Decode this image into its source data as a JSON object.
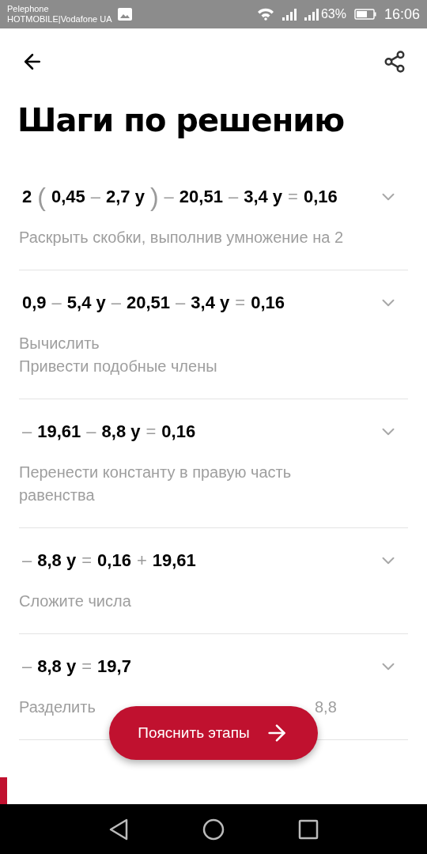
{
  "status_bar": {
    "carrier_top": "Pelephone",
    "carrier_bottom": "HOTMOBILE|Vodafone UA",
    "battery_text": "63%",
    "time": "16:06"
  },
  "title": "Шаги по решению",
  "steps": [
    {
      "expanded": false,
      "equation": [
        {
          "kind": "term",
          "text": "2"
        },
        {
          "kind": "paren",
          "text": "("
        },
        {
          "kind": "term",
          "text": "0,45"
        },
        {
          "kind": "op",
          "text": "–"
        },
        {
          "kind": "term",
          "text": "2,7 y"
        },
        {
          "kind": "paren",
          "text": ")"
        },
        {
          "kind": "op",
          "text": "–"
        },
        {
          "kind": "term",
          "text": "20,51"
        },
        {
          "kind": "op",
          "text": "–"
        },
        {
          "kind": "term",
          "text": "3,4 y"
        },
        {
          "kind": "op",
          "text": "="
        },
        {
          "kind": "term",
          "text": "0,16"
        }
      ],
      "description": [
        "Раскрыть скобки, выполнив умножение на 2"
      ]
    },
    {
      "expanded": false,
      "equation": [
        {
          "kind": "term",
          "text": "0,9"
        },
        {
          "kind": "op",
          "text": "–"
        },
        {
          "kind": "term",
          "text": "5,4 y"
        },
        {
          "kind": "op",
          "text": "–"
        },
        {
          "kind": "term",
          "text": "20,51"
        },
        {
          "kind": "op",
          "text": "–"
        },
        {
          "kind": "term",
          "text": "3,4 y"
        },
        {
          "kind": "op",
          "text": "="
        },
        {
          "kind": "term",
          "text": "0,16"
        }
      ],
      "description": [
        "Вычислить",
        "Привести подобные члены"
      ]
    },
    {
      "expanded": false,
      "equation": [
        {
          "kind": "op",
          "text": "–"
        },
        {
          "kind": "term",
          "text": "19,61"
        },
        {
          "kind": "op",
          "text": "–"
        },
        {
          "kind": "term",
          "text": "8,8 y"
        },
        {
          "kind": "op",
          "text": "="
        },
        {
          "kind": "term",
          "text": "0,16"
        }
      ],
      "description": [
        "Перенести константу в правую часть равенства"
      ]
    },
    {
      "expanded": false,
      "equation": [
        {
          "kind": "op",
          "text": "–"
        },
        {
          "kind": "term",
          "text": "8,8 y"
        },
        {
          "kind": "op",
          "text": "="
        },
        {
          "kind": "term",
          "text": "0,16"
        },
        {
          "kind": "op",
          "text": "+"
        },
        {
          "kind": "term",
          "text": "19,61"
        }
      ],
      "description": [
        "Сложите числа"
      ]
    },
    {
      "expanded": false,
      "equation": [
        {
          "kind": "op",
          "text": "–"
        },
        {
          "kind": "term",
          "text": "8,8 y"
        },
        {
          "kind": "op",
          "text": "="
        },
        {
          "kind": "term",
          "text": "19,7"
        }
      ],
      "description": [
        "Разделить"
      ],
      "description_end": "8,8"
    }
  ],
  "explain_button": {
    "label": "Пояснить этапы"
  }
}
